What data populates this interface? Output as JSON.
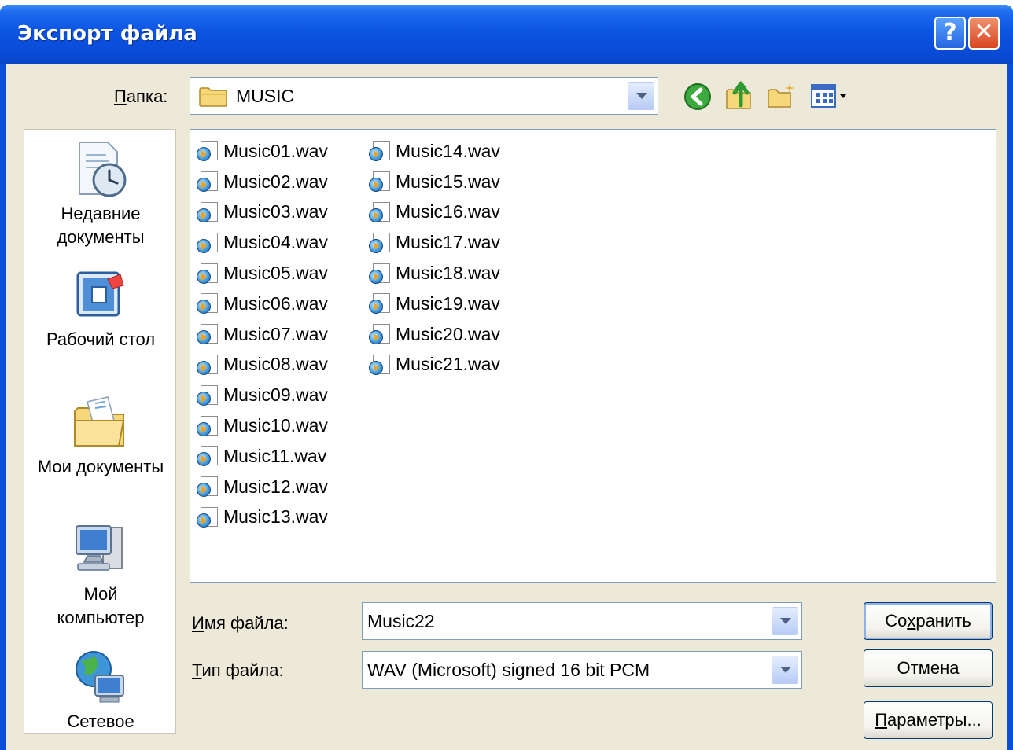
{
  "window": {
    "title": "Экспорт файла"
  },
  "titlebar": {
    "help_label": "?",
    "close_label": "✕"
  },
  "lookin": {
    "label_u": "П",
    "label_rest": "апка:",
    "value": "MUSIC",
    "folder_icon": "folder-icon"
  },
  "toolbar": {
    "icons": [
      "back-icon",
      "up-folder-icon",
      "new-folder-icon",
      "view-menu-icon"
    ]
  },
  "places": [
    {
      "label_line1": "Недавние",
      "label_line2": "документы",
      "icon": "recent-documents-icon"
    },
    {
      "label_line1": "Рабочий стол",
      "label_line2": "",
      "icon": "desktop-icon"
    },
    {
      "label_line1": "Мои документы",
      "label_line2": "",
      "icon": "my-documents-icon"
    },
    {
      "label_line1": "Мой",
      "label_line2": "компьютер",
      "icon": "my-computer-icon"
    },
    {
      "label_line1": "Сетевое",
      "label_line2": "",
      "icon": "network-icon"
    }
  ],
  "files": {
    "col1": [
      "Music01.wav",
      "Music02.wav",
      "Music03.wav",
      "Music04.wav",
      "Music05.wav",
      "Music06.wav",
      "Music07.wav",
      "Music08.wav",
      "Music09.wav",
      "Music10.wav",
      "Music11.wav",
      "Music12.wav",
      "Music13.wav"
    ],
    "col2": [
      "Music14.wav",
      "Music15.wav",
      "Music16.wav",
      "Music17.wav",
      "Music18.wav",
      "Music19.wav",
      "Music20.wav",
      "Music21.wav"
    ]
  },
  "filename": {
    "label_u": "И",
    "label_rest": "мя файла:",
    "value": "Music22"
  },
  "filetype": {
    "label_u": "Т",
    "label_rest": "ип файла:",
    "value": "WAV (Microsoft) signed 16 bit PCM"
  },
  "buttons": {
    "save": {
      "pre": "Со",
      "u": "х",
      "post": "ранить"
    },
    "cancel": {
      "label": "Отмена"
    },
    "params": {
      "pre": "",
      "u": "П",
      "post": "араметры..."
    }
  },
  "colors": {
    "titlebar": "#0a4fd6",
    "dialog_bg": "#ece9d8",
    "border": "#7f9db9"
  }
}
